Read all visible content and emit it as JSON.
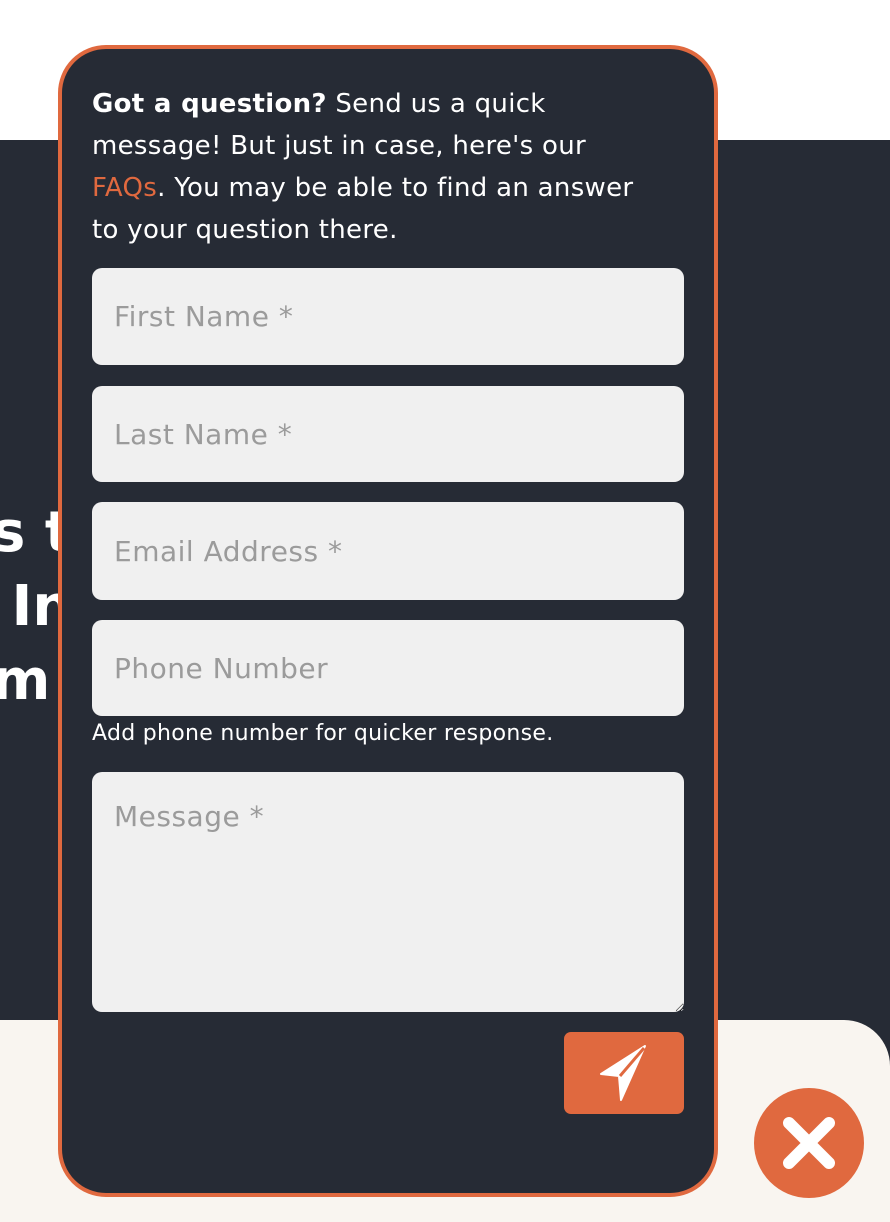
{
  "background": {
    "heading_lines": "s to\n In\nm e"
  },
  "popup": {
    "intro": {
      "bold": "Got a question?",
      "text_before_link": " Send us a quick message! But just in case, here's our ",
      "link": "FAQs",
      "text_after_link": ". You may be able to find an answer to your question there."
    },
    "fields": {
      "first_name_placeholder": "First Name *",
      "last_name_placeholder": "Last Name *",
      "email_placeholder": "Email Address *",
      "phone_placeholder": "Phone Number",
      "message_placeholder": "Message *"
    },
    "phone_hint": "Add phone number for quicker response.",
    "send_icon": "paper-plane-icon"
  },
  "close_icon": "close-icon",
  "colors": {
    "accent": "#e0693f",
    "panel_bg": "#262b35",
    "field_bg": "#f0f0f0",
    "placeholder": "#9b9b9b",
    "cream": "#f9f5f0"
  }
}
